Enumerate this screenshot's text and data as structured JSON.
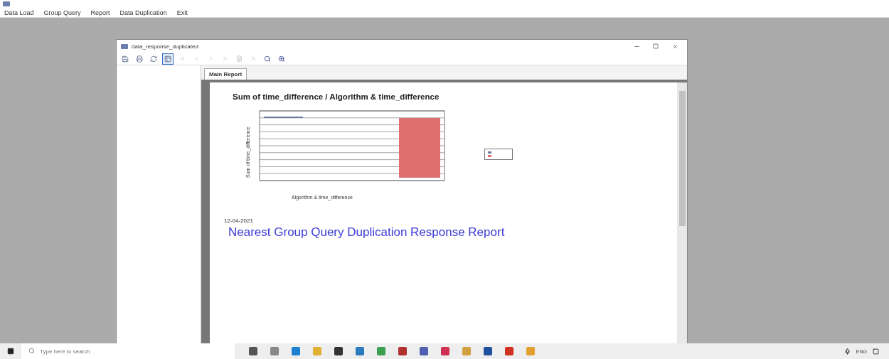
{
  "menu": [
    {
      "label": "Data Load"
    },
    {
      "label": "Group Query"
    },
    {
      "label": "Report"
    },
    {
      "label": "Data Duplication"
    },
    {
      "label": "Exit"
    }
  ],
  "child_window": {
    "title": "data_response_duplicated",
    "tabs": [
      {
        "label": "Main Report",
        "selected": true
      }
    ],
    "report": {
      "chart": {
        "title": "Sum of time_difference / Algorithm & time_difference",
        "xlabel": "Algorithm & time_difference",
        "ylabel": "Sum of time_difference"
      },
      "date": "12-04-2021",
      "heading": "Nearest Group Query Duplication Response Report"
    }
  },
  "taskbar": {
    "search": {
      "placeholder": "Type here to search"
    },
    "language": "ENG"
  }
}
